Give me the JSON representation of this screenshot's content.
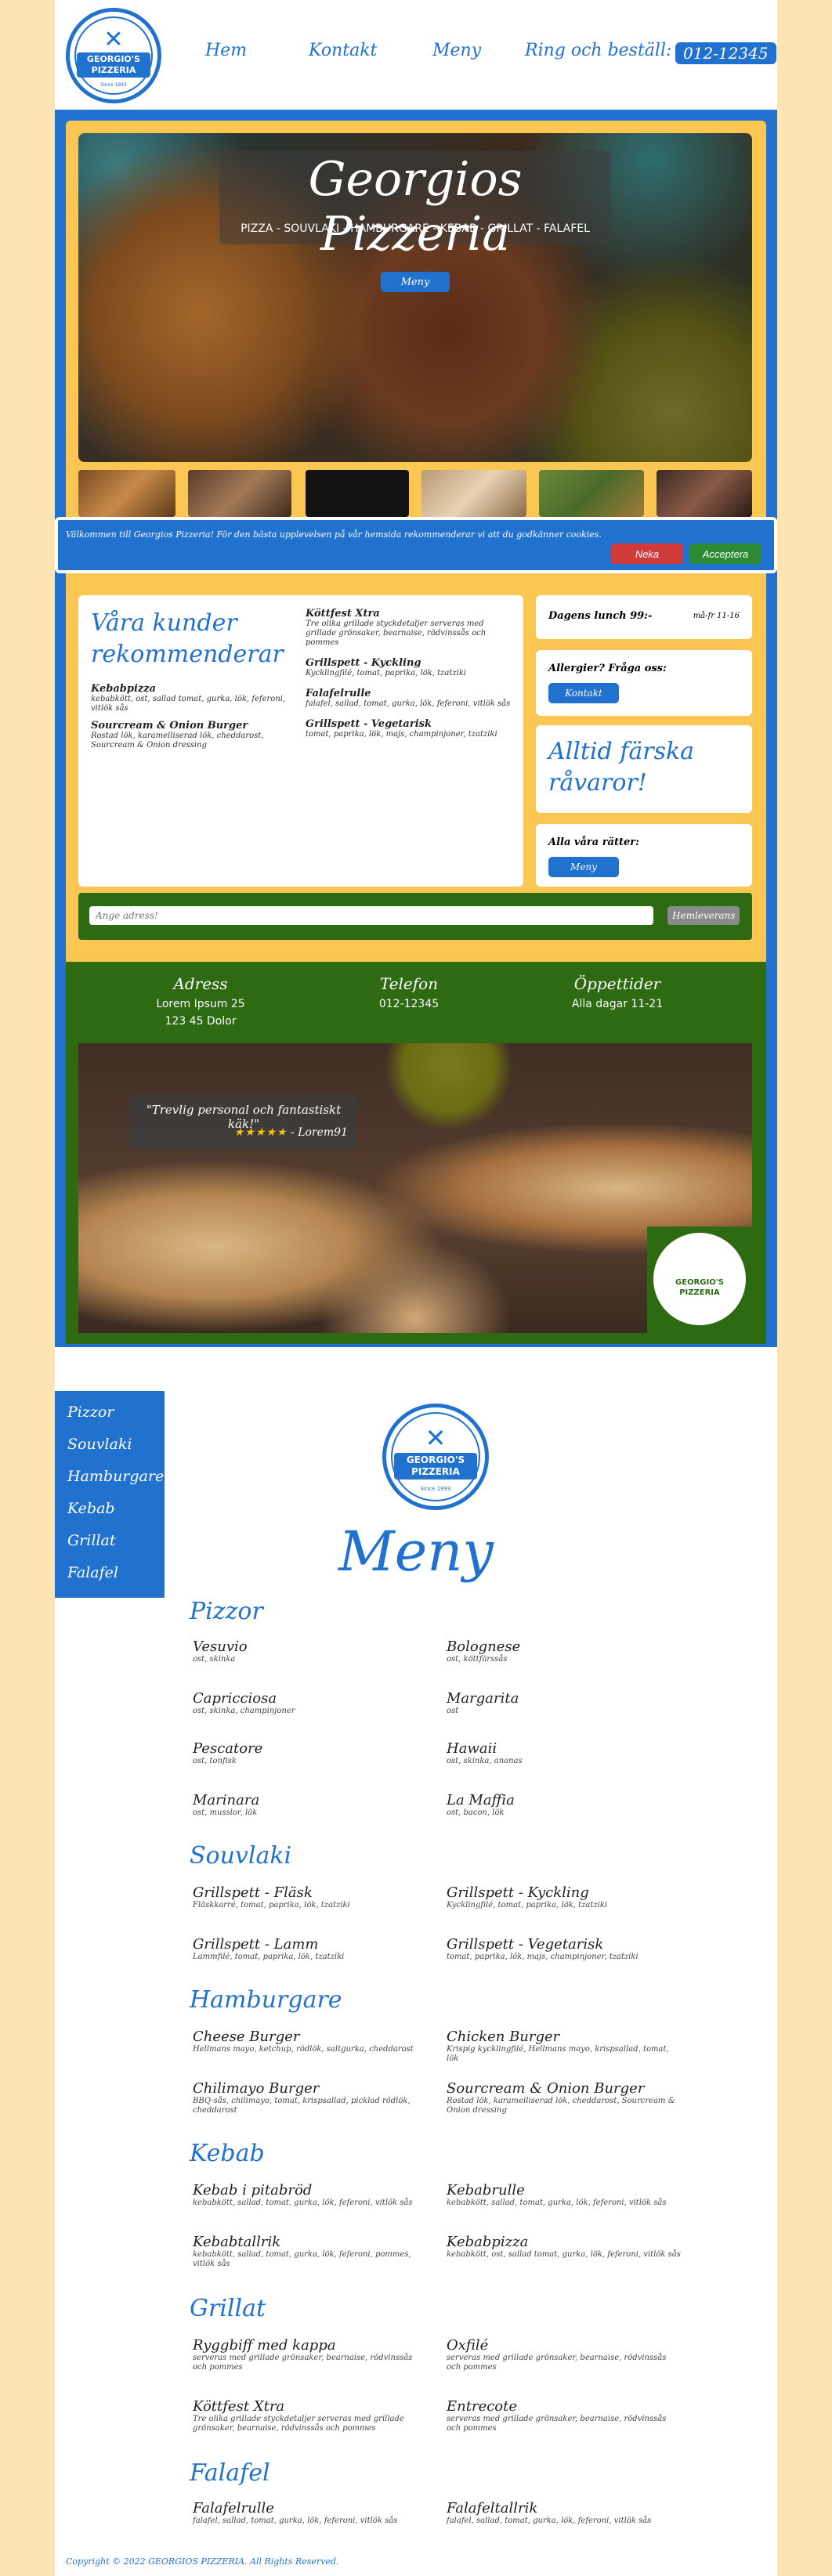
{
  "header": {
    "logo": {
      "top": "GEORGIO'S",
      "bottom": "PIZZERIA",
      "since": "Since 1993"
    },
    "nav": [
      "Hem",
      "Kontakt",
      "Meny"
    ],
    "call_label": "Ring och beställ:",
    "phone": "012-12345"
  },
  "hero": {
    "title": "Georgios Pizzeria",
    "subtitle": "PIZZA - SOUVLAKI - HAMBURGARE - KEBAB - GRILLAT - FALAFEL",
    "button": "Meny"
  },
  "cookie": {
    "text": "Välkommen till Georgios Pizzeria! För den bästa upplevelsen på vår hemsida rekommenderar vi att du godkänner cookies.",
    "decline": "Neka",
    "accept": "Acceptera"
  },
  "recommend": {
    "title": "Våra kunder rekommenderar",
    "items": [
      {
        "name": "Kebabpizza",
        "desc": "kebabkött, ost, sallad tomat, gurka, lök, feferoni, vitlök sås"
      },
      {
        "name": "Sourcream & Onion Burger",
        "desc": "Rostad lök, karamelliserad lök, cheddarost, Sourcream & Onion dressing"
      },
      {
        "name": "Köttfest Xtra",
        "desc": "Tre olika grillade styckdetaljer serveras med grillade grönsaker, bearnaise, rödvinssås och pommes"
      },
      {
        "name": "Grillspett - Kyckling",
        "desc": "Kycklingfilé, tomat, paprika, lök, tzatziki"
      },
      {
        "name": "Falafelrulle",
        "desc": "falafel, sallad, tomat, gurka, lök, feferoni, vitlök sås"
      },
      {
        "name": "Grillspett - Vegetarisk",
        "desc": "tomat, paprika, lök, majs, champinjoner, tzatziki"
      }
    ]
  },
  "lunch": {
    "label": "Dagens lunch 99:-",
    "hours": "må-fr 11-16"
  },
  "allergy": {
    "label": "Allergier? Fråga oss:",
    "button": "Kontakt"
  },
  "fresh": {
    "text": "Alltid färska råvaror!"
  },
  "dishes": {
    "label": "Alla våra rätter:",
    "button": "Meny"
  },
  "address_search": {
    "placeholder": "Ange adress!",
    "button": "Hemleverans"
  },
  "info": {
    "address_title": "Adress",
    "address_line1": "Lorem Ipsum 25",
    "address_line2": "123 45 Dolor",
    "phone_title": "Telefon",
    "phone": "012-12345",
    "hours_title": "Öppettider",
    "hours": "Alla dagar 11-21"
  },
  "review": {
    "quote": "\"Trevlig personal och fantastiskt käk!\"",
    "stars": "★★★★★",
    "author": "- Lorem91"
  },
  "side_nav": [
    "Pizzor",
    "Souvlaki",
    "Hamburgare",
    "Kebab",
    "Grillat",
    "Falafel"
  ],
  "menu": {
    "title": "Meny",
    "categories": [
      {
        "title": "Pizzor",
        "items": [
          {
            "name": "Vesuvio",
            "desc": "ost, skinka"
          },
          {
            "name": "Bolognese",
            "desc": "ost, köttfärssås"
          },
          {
            "name": "Capricciosa",
            "desc": "ost, skinka, champinjoner"
          },
          {
            "name": "Margarita",
            "desc": "ost"
          },
          {
            "name": "Pescatore",
            "desc": "ost, tonfisk"
          },
          {
            "name": "Hawaii",
            "desc": "ost, skinka, ananas"
          },
          {
            "name": "Marinara",
            "desc": "ost, musslor, lök"
          },
          {
            "name": "La Maffia",
            "desc": "ost, bacon, lök"
          }
        ]
      },
      {
        "title": "Souvlaki",
        "items": [
          {
            "name": "Grillspett - Fläsk",
            "desc": "Fläskkarré, tomat, paprika, lök, tzatziki"
          },
          {
            "name": "Grillspett - Kyckling",
            "desc": "Kycklingfilé, tomat, paprika, lök, tzatziki"
          },
          {
            "name": "Grillspett - Lamm",
            "desc": "Lammfilé, tomat, paprika, lök, tzatziki"
          },
          {
            "name": "Grillspett - Vegetarisk",
            "desc": "tomat, paprika, lök, majs, champinjoner, tzatziki"
          }
        ]
      },
      {
        "title": "Hamburgare",
        "items": [
          {
            "name": "Cheese Burger",
            "desc": "Hellmans mayo, ketchup, rödlök, saltgurka, cheddarost"
          },
          {
            "name": "Chicken Burger",
            "desc": "Krispig kycklingfilé, Hellmans mayo, krispsallad, tomat, lök"
          },
          {
            "name": "Chilimayo Burger",
            "desc": "BBQ-sås, chilimayo, tomat, krispsallad, picklad rödlök, cheddarost"
          },
          {
            "name": "Sourcream & Onion Burger",
            "desc": "Rostad lök, karamelliserad lök, cheddarost, Sourcream & Onion dressing"
          }
        ]
      },
      {
        "title": "Kebab",
        "items": [
          {
            "name": "Kebab i pitabröd",
            "desc": "kebabkött, sallad, tomat, gurka, lök, feferoni, vitlök sås"
          },
          {
            "name": "Kebabrulle",
            "desc": "kebabkött, sallad, tomat, gurka, lök, feferoni, vitlök sås"
          },
          {
            "name": "Kebabtallrik",
            "desc": "kebabkött, sallad, tomat, gurka, lök, feferoni, pommes, vitlök sås"
          },
          {
            "name": "Kebabpizza",
            "desc": "kebabkött, ost, sallad tomat, gurka, lök, feferoni, vitlök sås"
          }
        ]
      },
      {
        "title": "Grillat",
        "items": [
          {
            "name": "Ryggbiff med kappa",
            "desc": "serveras med grillade grönsaker, bearnaise, rödvinssås och pommes"
          },
          {
            "name": "Oxfilé",
            "desc": "serveras med grillade grönsaker, bearnaise, rödvinssås och pommes"
          },
          {
            "name": "Köttfest Xtra",
            "desc": "Tre olika grillade styckdetaljer serveras med grillade grönsaker, bearnaise, rödvinssås och pommes"
          },
          {
            "name": "Entrecote",
            "desc": "serveras med grillade grönsaker, bearnaise, rödvinssås och pommes"
          }
        ]
      },
      {
        "title": "Falafel",
        "items": [
          {
            "name": "Falafelrulle",
            "desc": "falafel, sallad, tomat, gurka, lök, feferoni, vitlök sås"
          },
          {
            "name": "Falafeltallrik",
            "desc": "falafel, sallad, tomat, gurka, lök, feferoni, vitlök sås"
          }
        ]
      }
    ]
  },
  "footer": {
    "copyright": "Copyright © 2022 GEORGIOS PIZZERIA. All Rights Reserved."
  },
  "colors": {
    "brand_blue": "#2171cf",
    "yellow": "#fcc653",
    "green": "#2d6a12",
    "cream": "#fde4b2",
    "decline_red": "#d13b3b",
    "accept_green": "#2d8a34"
  }
}
